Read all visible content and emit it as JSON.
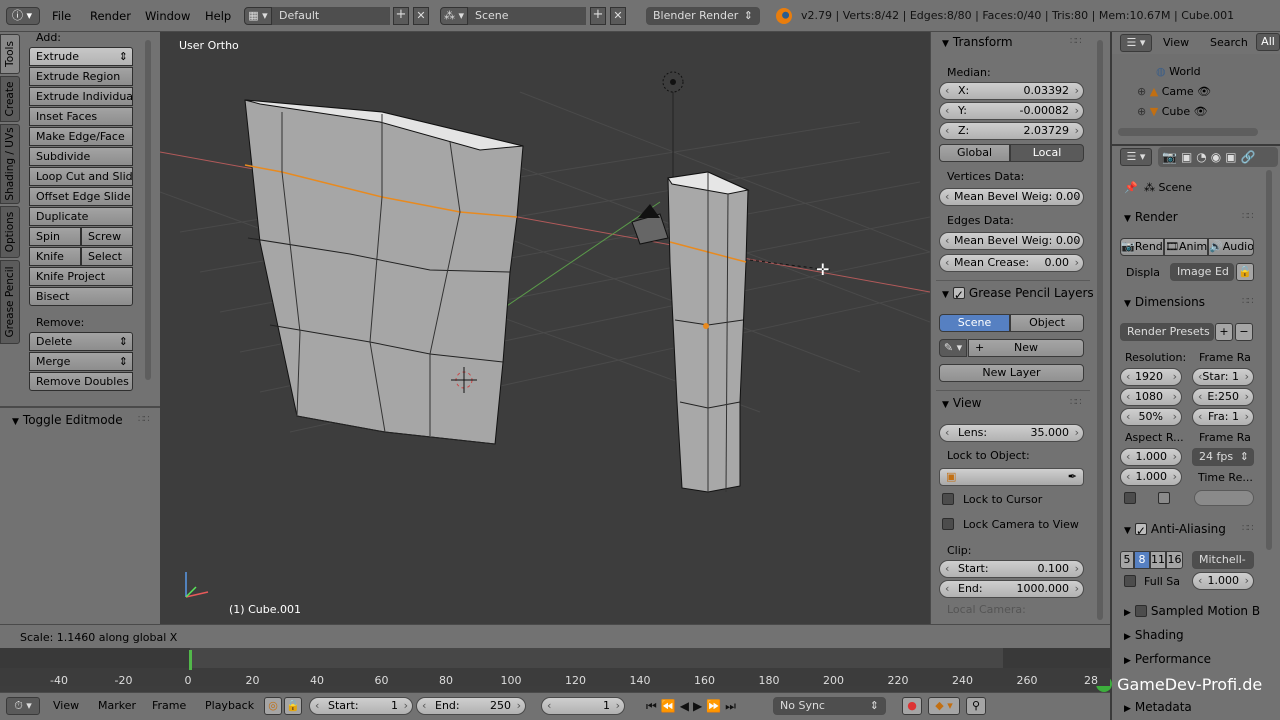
{
  "topbar": {
    "menus": [
      "File",
      "Render",
      "Window",
      "Help"
    ],
    "layout": "Default",
    "scene": "Scene",
    "engine": "Blender Render",
    "stats": "v2.79 | Verts:8/42 | Edges:8/80 | Faces:0/40 | Tris:80 | Mem:10.67M | Cube.001"
  },
  "tool_tabs": [
    "Tools",
    "Create",
    "Shading / UVs",
    "Options",
    "Grease Pencil"
  ],
  "tools": {
    "add_label": "Add:",
    "items": [
      "Extrude",
      "Extrude Region",
      "Extrude Individual",
      "Inset Faces",
      "Make Edge/Face",
      "Subdivide",
      "Loop Cut and Slide",
      "Offset Edge Slide",
      "Duplicate"
    ],
    "spin": "Spin",
    "screw": "Screw",
    "knife": "Knife",
    "select": "Select",
    "knife_project": "Knife Project",
    "bisect": "Bisect",
    "remove_label": "Remove:",
    "delete": "Delete",
    "merge": "Merge",
    "remove_doubles": "Remove Doubles",
    "toggle_editmode": "Toggle Editmode"
  },
  "viewport": {
    "view_name": "User Ortho",
    "object_name": "(1) Cube.001",
    "status": "Scale: 1.1460 along global X"
  },
  "properties_n": {
    "transform_title": "Transform",
    "median_label": "Median:",
    "x_label": "X:",
    "x": "0.03392",
    "y_label": "Y:",
    "y": "-0.00082",
    "z_label": "Z:",
    "z": "2.03729",
    "global": "Global",
    "local": "Local",
    "vertices_data": "Vertices Data:",
    "mean_bevel_weight_v": "Mean Bevel Weig: 0.00",
    "edges_data": "Edges Data:",
    "mean_bevel_weight_e": "Mean Bevel Weig: 0.00",
    "mean_crease_label": "Mean Crease:",
    "mean_crease": "0.00",
    "grease_title": "Grease Pencil Layers",
    "scene_btn": "Scene",
    "object_btn": "Object",
    "new": "New",
    "new_layer": "New Layer",
    "view_title": "View",
    "lens_label": "Lens:",
    "lens": "35.000",
    "lock_to_object": "Lock to Object:",
    "lock_to_cursor": "Lock to Cursor",
    "lock_camera": "Lock Camera to View",
    "clip_label": "Clip:",
    "start_label": "Start:",
    "start": "0.100",
    "end_label": "End:",
    "end": "1000.000",
    "local_camera": "Local Camera:"
  },
  "outliner": {
    "view": "View",
    "search": "Search",
    "all": "All",
    "items": [
      "World",
      "Came",
      "Cube"
    ]
  },
  "render_props": {
    "scene": "Scene",
    "render_title": "Render",
    "rend": "Rend",
    "anim": "Anim",
    "audio": "Audio",
    "display_label": "Displa",
    "display_value": "Image Ed",
    "dimensions_title": "Dimensions",
    "render_presets": "Render Presets",
    "resolution_label": "Resolution:",
    "frame_range_label": "Frame Ra",
    "res_x": "1920",
    "res_y": "1080",
    "res_pct": "50%",
    "frame_start": "Star: 1",
    "frame_end": "E:250",
    "frame_step": "Fra: 1",
    "aspect_label": "Aspect R...",
    "frame_rate_label": "Frame Ra",
    "aspect_x": "1.000",
    "aspect_y": "1.000",
    "fps": "24 fps",
    "time_remap": "Time Re...",
    "aa_title": "Anti-Aliasing",
    "aa_samples": [
      "5",
      "8",
      "11",
      "16"
    ],
    "aa_filter": "Mitchell-",
    "full_sample": "Full Sa",
    "aa_size": "1.000",
    "sampled_motion": "Sampled Motion Bl",
    "shading": "Shading",
    "performance": "Performance",
    "metadata": "Metadata"
  },
  "timeline": {
    "ticks": [
      "-40",
      "-20",
      "0",
      "20",
      "40",
      "60",
      "80",
      "100",
      "120",
      "140",
      "160",
      "180",
      "200",
      "220",
      "240",
      "260",
      "28"
    ]
  },
  "bottombar": {
    "view": "View",
    "marker": "Marker",
    "frame": "Frame",
    "playback": "Playback",
    "start_label": "Start:",
    "start": "1",
    "end_label": "End:",
    "end": "250",
    "current": "1",
    "sync": "No Sync"
  },
  "watermark": "GameDev-Profi.de"
}
